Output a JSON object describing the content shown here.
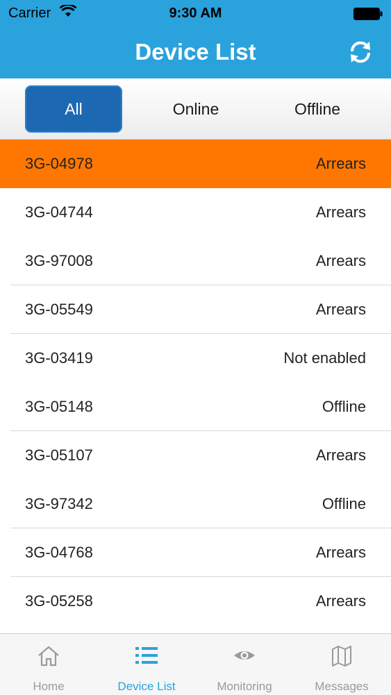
{
  "status_bar": {
    "carrier": "Carrier",
    "time": "9:30 AM"
  },
  "header": {
    "title": "Device List",
    "refresh_icon": "refresh-icon"
  },
  "segments": [
    {
      "label": "All",
      "active": true
    },
    {
      "label": "Online",
      "active": false
    },
    {
      "label": "Offline",
      "active": false
    }
  ],
  "devices": [
    {
      "id": "3G-04978",
      "status": "Arrears",
      "selected": true
    },
    {
      "id": "3G-04744",
      "status": "Arrears"
    },
    {
      "id": "3G-97008",
      "status": "Arrears"
    },
    {
      "id": "3G-05549",
      "status": "Arrears"
    },
    {
      "id": "3G-03419",
      "status": "Not enabled"
    },
    {
      "id": "3G-05148",
      "status": "Offline"
    },
    {
      "id": "3G-05107",
      "status": "Arrears"
    },
    {
      "id": "3G-97342",
      "status": "Offline"
    },
    {
      "id": "3G-04768",
      "status": "Arrears"
    },
    {
      "id": "3G-05258",
      "status": "Arrears"
    }
  ],
  "tabbar": [
    {
      "label": "Home",
      "icon": "home-icon"
    },
    {
      "label": "Device List",
      "icon": "list-icon",
      "active": true
    },
    {
      "label": "Monitoring",
      "icon": "eye-icon"
    },
    {
      "label": "Messages",
      "icon": "map-icon"
    }
  ],
  "colors": {
    "header": "#2aa2dc",
    "selected_row": "#ff7700",
    "segment_active": "#1d69b1"
  }
}
